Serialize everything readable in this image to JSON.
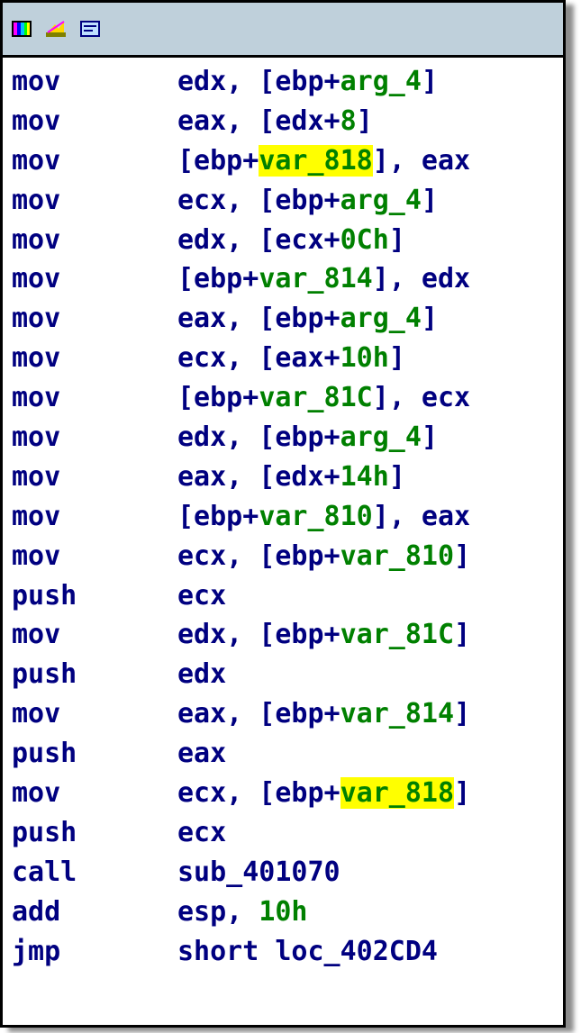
{
  "toolbar": {
    "icons": [
      "graph-view-icon",
      "flowchart-icon",
      "text-view-icon"
    ]
  },
  "colors": {
    "instruction": "#000080",
    "name": "#008000",
    "highlight": "#ffff00",
    "titlebar": "#bfd0db"
  },
  "lines": [
    {
      "mn": "mov",
      "op": [
        [
          "edx, [ebp+",
          ""
        ],
        [
          "arg_4",
          "g"
        ],
        [
          "]",
          ""
        ]
      ]
    },
    {
      "mn": "mov",
      "op": [
        [
          "eax, [edx+",
          ""
        ],
        [
          "8",
          "g"
        ],
        [
          "]",
          ""
        ]
      ]
    },
    {
      "mn": "mov",
      "op": [
        [
          "[ebp+",
          ""
        ],
        [
          "var_818",
          "g hl"
        ],
        [
          "], eax",
          ""
        ]
      ]
    },
    {
      "mn": "mov",
      "op": [
        [
          "ecx, [ebp+",
          ""
        ],
        [
          "arg_4",
          "g"
        ],
        [
          "]",
          ""
        ]
      ]
    },
    {
      "mn": "mov",
      "op": [
        [
          "edx, [ecx+",
          ""
        ],
        [
          "0Ch",
          "g"
        ],
        [
          "]",
          ""
        ]
      ]
    },
    {
      "mn": "mov",
      "op": [
        [
          "[ebp+",
          ""
        ],
        [
          "var_814",
          "g"
        ],
        [
          "], edx",
          ""
        ]
      ]
    },
    {
      "mn": "mov",
      "op": [
        [
          "eax, [ebp+",
          ""
        ],
        [
          "arg_4",
          "g"
        ],
        [
          "]",
          ""
        ]
      ]
    },
    {
      "mn": "mov",
      "op": [
        [
          "ecx, [eax+",
          ""
        ],
        [
          "10h",
          "g"
        ],
        [
          "]",
          ""
        ]
      ]
    },
    {
      "mn": "mov",
      "op": [
        [
          "[ebp+",
          ""
        ],
        [
          "var_81C",
          "g"
        ],
        [
          "], ecx",
          ""
        ]
      ]
    },
    {
      "mn": "mov",
      "op": [
        [
          "edx, [ebp+",
          ""
        ],
        [
          "arg_4",
          "g"
        ],
        [
          "]",
          ""
        ]
      ]
    },
    {
      "mn": "mov",
      "op": [
        [
          "eax, [edx+",
          ""
        ],
        [
          "14h",
          "g"
        ],
        [
          "]",
          ""
        ]
      ]
    },
    {
      "mn": "mov",
      "op": [
        [
          "[ebp+",
          ""
        ],
        [
          "var_810",
          "g"
        ],
        [
          "], eax",
          ""
        ]
      ]
    },
    {
      "mn": "mov",
      "op": [
        [
          "ecx, [ebp+",
          ""
        ],
        [
          "var_810",
          "g"
        ],
        [
          "]",
          ""
        ]
      ]
    },
    {
      "mn": "push",
      "op": [
        [
          "ecx",
          ""
        ]
      ]
    },
    {
      "mn": "mov",
      "op": [
        [
          "edx, [ebp+",
          ""
        ],
        [
          "var_81C",
          "g"
        ],
        [
          "]",
          ""
        ]
      ]
    },
    {
      "mn": "push",
      "op": [
        [
          "edx",
          ""
        ]
      ]
    },
    {
      "mn": "mov",
      "op": [
        [
          "eax, [ebp+",
          ""
        ],
        [
          "var_814",
          "g"
        ],
        [
          "]",
          ""
        ]
      ]
    },
    {
      "mn": "push",
      "op": [
        [
          "eax",
          ""
        ]
      ]
    },
    {
      "mn": "mov",
      "op": [
        [
          "ecx, [ebp+",
          ""
        ],
        [
          "var_818",
          "g hl"
        ],
        [
          "]",
          ""
        ]
      ]
    },
    {
      "mn": "push",
      "op": [
        [
          "ecx",
          ""
        ]
      ]
    },
    {
      "mn": "call",
      "op": [
        [
          "sub_401070",
          ""
        ]
      ]
    },
    {
      "mn": "add",
      "op": [
        [
          "esp, ",
          ""
        ],
        [
          "10h",
          "g"
        ]
      ]
    },
    {
      "mn": "jmp",
      "op": [
        [
          "short loc_402CD4",
          ""
        ]
      ]
    }
  ]
}
